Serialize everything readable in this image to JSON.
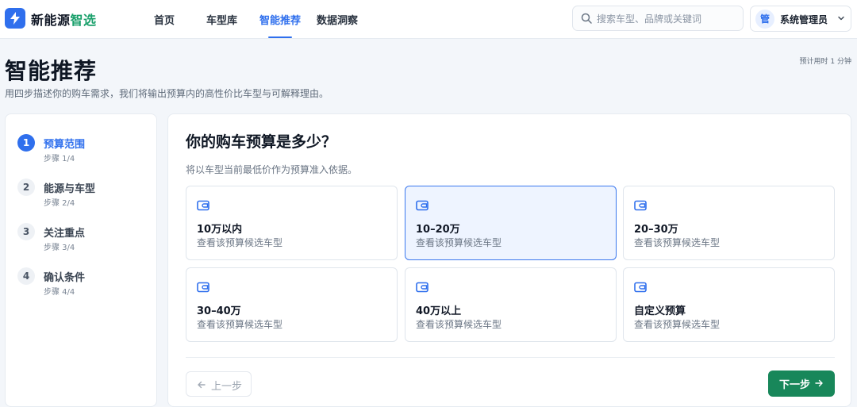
{
  "brand": {
    "name_main": "新能源",
    "name_accent": "智选"
  },
  "nav": {
    "items": [
      {
        "label": "首页"
      },
      {
        "label": "车型库"
      },
      {
        "label": "智能推荐"
      },
      {
        "label": "数据洞察"
      }
    ],
    "active": "智能推荐"
  },
  "search": {
    "placeholder": "搜索车型、品牌或关键词",
    "value": ""
  },
  "user": {
    "avatar": "管",
    "name": "系统管理员"
  },
  "page": {
    "title": "智能推荐",
    "subtitle": "用四步描述你的购车需求，我们将输出预算内的高性价比车型与可解释理由。",
    "estimate": "预计用时 1 分钟"
  },
  "steps": [
    {
      "num": "1",
      "title": "预算范围",
      "count": "步骤 1/4"
    },
    {
      "num": "2",
      "title": "能源与车型",
      "count": "步骤 2/4"
    },
    {
      "num": "3",
      "title": "关注重点",
      "count": "步骤 3/4"
    },
    {
      "num": "4",
      "title": "确认条件",
      "count": "步骤 4/4"
    }
  ],
  "current_step": 1,
  "question": {
    "title": "你的购车预算是多少？",
    "desc": "将以车型当前最低价作为预算准入依据。"
  },
  "options": [
    {
      "title": "10万以内",
      "desc": "查看该预算候选车型"
    },
    {
      "title": "10–20万",
      "desc": "查看该预算候选车型"
    },
    {
      "title": "20–30万",
      "desc": "查看该预算候选车型"
    },
    {
      "title": "30–40万",
      "desc": "查看该预算候选车型"
    },
    {
      "title": "40万以上",
      "desc": "查看该预算候选车型"
    },
    {
      "title": "自定义预算",
      "desc": "查看该预算候选车型"
    }
  ],
  "selected_option": "10–20万",
  "buttons": {
    "prev": "上一步",
    "next": "下一步"
  },
  "colors": {
    "primary": "#2f6fed",
    "accent_green": "#1aa06b",
    "next_button": "#18875a",
    "selected_bg": "#eef4ff"
  },
  "icons": {
    "logo": "bolt-icon",
    "search": "search-icon",
    "user_menu": "chevron-down-icon",
    "option": "wallet-icon",
    "prev": "arrow-left-icon",
    "next": "arrow-right-icon"
  }
}
